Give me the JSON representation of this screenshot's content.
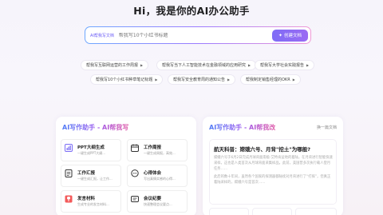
{
  "hero": {
    "title": "Hi，我是你的AI办公助手"
  },
  "search": {
    "tag": "AI帮我写文档",
    "placeholder": "帮我写10个小红书标题",
    "create_label": "创建文档"
  },
  "suggestions": [
    {
      "label": "帮我写互联网运营的工作周报"
    },
    {
      "label": "帮我写当下人工智能技术在金融领域的应用研究"
    },
    {
      "label": "帮我写大学社会实践报告"
    },
    {
      "label": "帮我写10个小红书种草笔记标题"
    },
    {
      "label": "帮我写安全教育周的通知公告"
    },
    {
      "label": "帮我制定销售经理的OKR"
    }
  ],
  "left_card": {
    "title": "AI写作助手 - AI帮我写",
    "tiles": [
      {
        "title": "PPT大纲生成",
        "desc": "一键生成PPT大纲..."
      },
      {
        "title": "工作周报",
        "desc": "一键生成周报，高效..."
      },
      {
        "title": "工作汇报",
        "desc": "一键生成汇报，让工作..."
      },
      {
        "title": "心得体会",
        "desc": "写出真情实感的心得..."
      },
      {
        "title": "发言材料",
        "desc": "生成专业的发言材料..."
      },
      {
        "title": "会议纪要",
        "desc": "快速整理会议要点..."
      }
    ]
  },
  "right_card": {
    "title": "AI写作助手 - AI帮我改",
    "swap_label": "换一篇文档",
    "article": {
      "title": "航天科普：嫦娥六号、月背\"挖土\"为哪般?",
      "paragraphs": [
        "嫦娥六号于6月2日完成月球背面南极-艾特肯盆地的着陆，在月背进行智能快速采样，这也是人类首次从月球背面采集样品。此前，美国曾多次执行载人登月任务……",
        "此后的数十年间，虽然各个国家的探测器都陆续对月背进行了“打探”，但真正着陆采样的，嫦娥六号是首次……"
      ]
    }
  },
  "colors": {
    "accent": "#7f6cf6",
    "title_gradient_start": "#4f7cf5",
    "title_gradient_end": "#e05ba8"
  }
}
